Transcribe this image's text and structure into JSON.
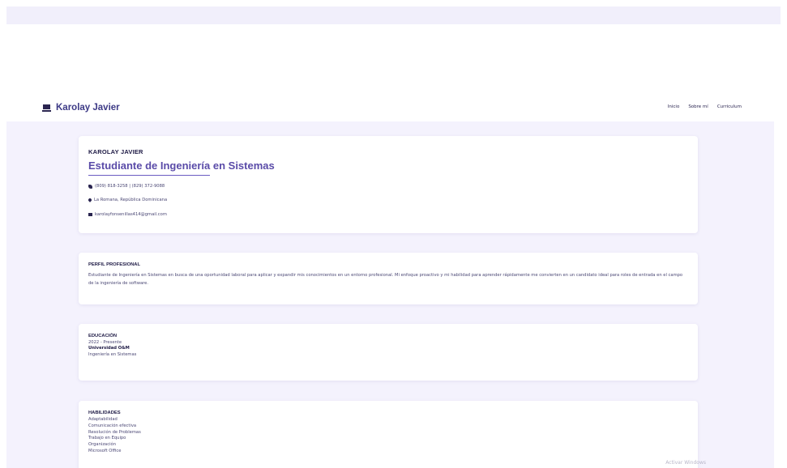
{
  "navbar": {
    "brand": "Karolay Javier",
    "links": [
      "Inicio",
      "Sobre mí",
      "Curriculum"
    ]
  },
  "header_card": {
    "name": "KAROLAY JAVIER",
    "role": "Estudiante de Ingeniería en Sistemas",
    "phone": "(809) 818-3258 | (829) 372-9088",
    "location": "La Romana, República Dominicana",
    "email": "karolayfonsenillas414@gmail.com"
  },
  "perfil": {
    "title": "PERFIL PROFESIONAL",
    "text": "Estudiante de Ingeniería en Sistemas en busca de una oportunidad laboral para aplicar y expandir mis conocimientos en un entorno profesional. Mi enfoque proactivo y mi habilidad para aprender rápidamente me convierten en un candidato ideal para roles de entrada en el campo de la ingeniería de software."
  },
  "educacion": {
    "title": "EDUCACIÓN",
    "period": "2022 - Presente",
    "institution": "Universidad O&M",
    "degree": "Ingeniería en Sistemas"
  },
  "habilidades": {
    "title": "HABILIDADES",
    "items": [
      "Adaptabilidad",
      "Comunicación efectiva",
      "Resolución de Problemas",
      "Trabajo en Equipo",
      "Organización",
      "Microsoft Office"
    ]
  },
  "system": {
    "watermark": "Activar Windows"
  },
  "colors": {
    "accent": "#5a4ba8",
    "background": "#f4f2fd",
    "text_dark": "#1e1a45"
  }
}
